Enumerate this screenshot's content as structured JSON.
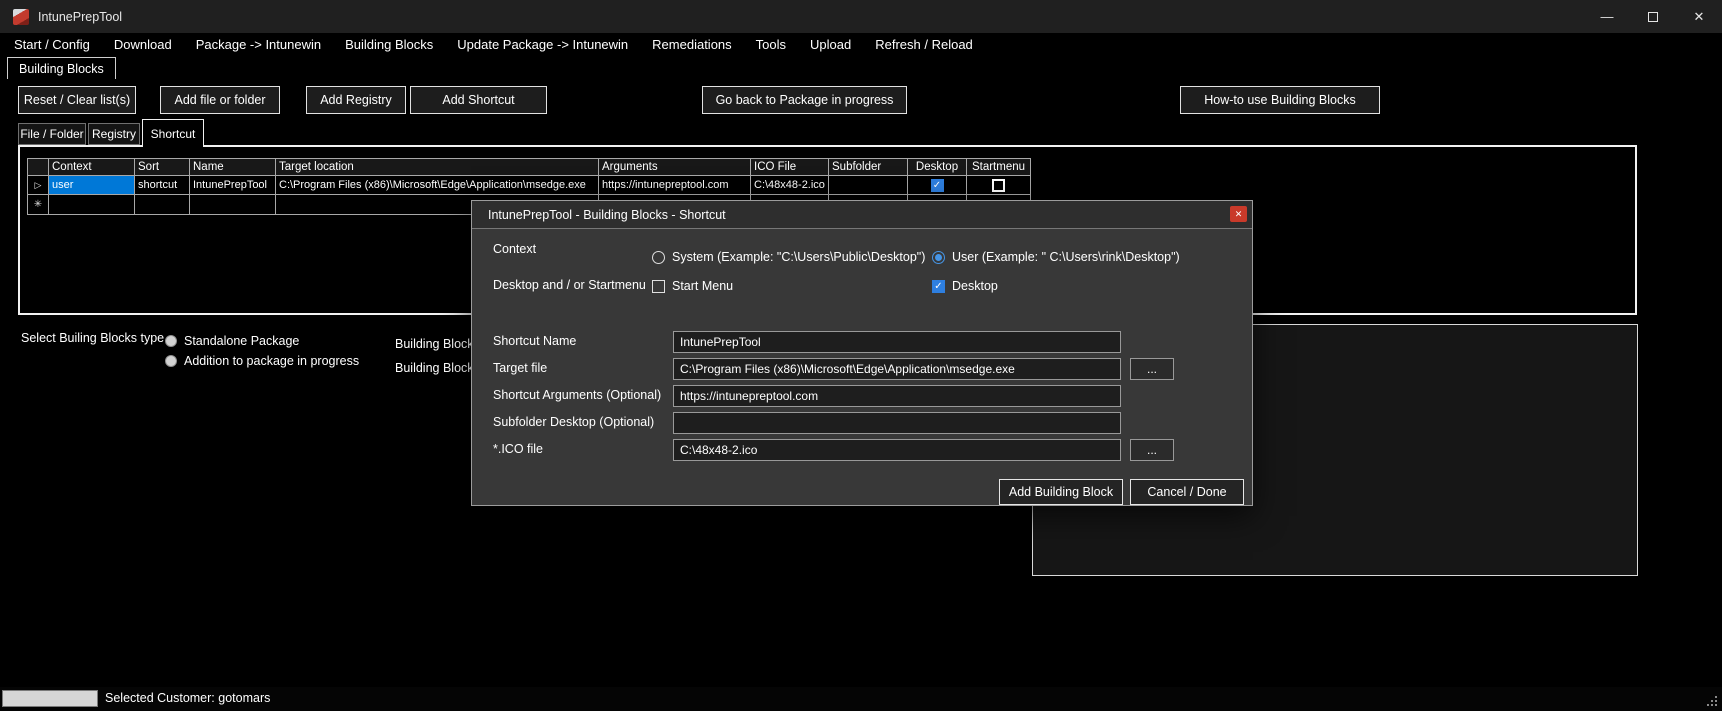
{
  "window": {
    "title": "IntunePrepTool"
  },
  "icons": {
    "app": "toolbox",
    "minimize": "—",
    "maximize": "square-outline",
    "close": "✕",
    "dialog_close": "✕",
    "current_row": "▷",
    "new_row": "✳",
    "browse": "...",
    "check": "✓"
  },
  "colors": {
    "accent_blue": "#0078d7",
    "close_red": "#c93a2a"
  },
  "menubar": {
    "items": [
      {
        "label": "Start / Config"
      },
      {
        "label": "Download"
      },
      {
        "label": "Package -> Intunewin"
      },
      {
        "label": "Building Blocks"
      },
      {
        "label": "Update Package -> Intunewin"
      },
      {
        "label": "Remediations"
      },
      {
        "label": "Tools"
      },
      {
        "label": "Upload"
      },
      {
        "label": "Refresh / Reload"
      }
    ]
  },
  "main_tab": {
    "label": "Building Blocks"
  },
  "toolbar": {
    "reset": "Reset / Clear list(s)",
    "add_file": "Add file or folder",
    "add_registry": "Add Registry",
    "add_shortcut": "Add Shortcut",
    "go_back": "Go back to Package in progress",
    "howto": "How-to use Building Blocks"
  },
  "subtabs": {
    "items": [
      {
        "label": "File / Folder",
        "selected": false
      },
      {
        "label": "Registry",
        "selected": false
      },
      {
        "label": "Shortcut",
        "selected": true
      }
    ]
  },
  "grid": {
    "columns": [
      "Context",
      "Sort",
      "Name",
      "Target location",
      "Arguments",
      "ICO File",
      "Subfolder",
      "Desktop",
      "Startmenu"
    ],
    "rows": [
      {
        "context": "user",
        "sort": "shortcut",
        "name": "IntunePrepTool",
        "target_location": "C:\\Program Files (x86)\\Microsoft\\Edge\\Application\\msedge.exe",
        "arguments": "https://intunepreptool.com",
        "ico_file": "C:\\48x48-2.ico",
        "subfolder": "",
        "desktop_checked": true,
        "startmenu_checked": false
      }
    ]
  },
  "blocks_type": {
    "label": "Select Builing Blocks type",
    "option_standalone": "Standalone Package",
    "option_addition": "Addition to package in progress",
    "partial_label_1": "Building Block",
    "partial_label_2": "Building Block"
  },
  "dialog": {
    "title": "IntunePrepTool - Building Blocks - Shortcut",
    "context_label": "Context",
    "radio_system_label": "System (Example: \"C:\\Users\\Public\\Desktop\")",
    "radio_user_label": "User (Example: \" C:\\Users\\rink\\Desktop\")",
    "radio_system_selected": false,
    "radio_user_selected": true,
    "desktop_startmenu_label": "Desktop and / or Startmenu",
    "startmenu_checkbox_label": "Start Menu",
    "desktop_checkbox_label": "Desktop",
    "startmenu_checked": false,
    "desktop_checked": true,
    "fields": [
      {
        "label": "Shortcut Name",
        "value": "IntunePrepTool"
      },
      {
        "label": "Target file",
        "value": "C:\\Program Files (x86)\\Microsoft\\Edge\\Application\\msedge.exe"
      },
      {
        "label": "Shortcut Arguments (Optional)",
        "value": "https://intunepreptool.com"
      },
      {
        "label": "Subfolder Desktop (Optional)",
        "value": ""
      },
      {
        "label": "*.ICO file",
        "value": "C:\\48x48-2.ico"
      }
    ],
    "browse_label": "...",
    "add_button": "Add Building Block",
    "cancel_button": "Cancel / Done"
  },
  "statusbar": {
    "text": "Selected Customer: gotomars"
  }
}
